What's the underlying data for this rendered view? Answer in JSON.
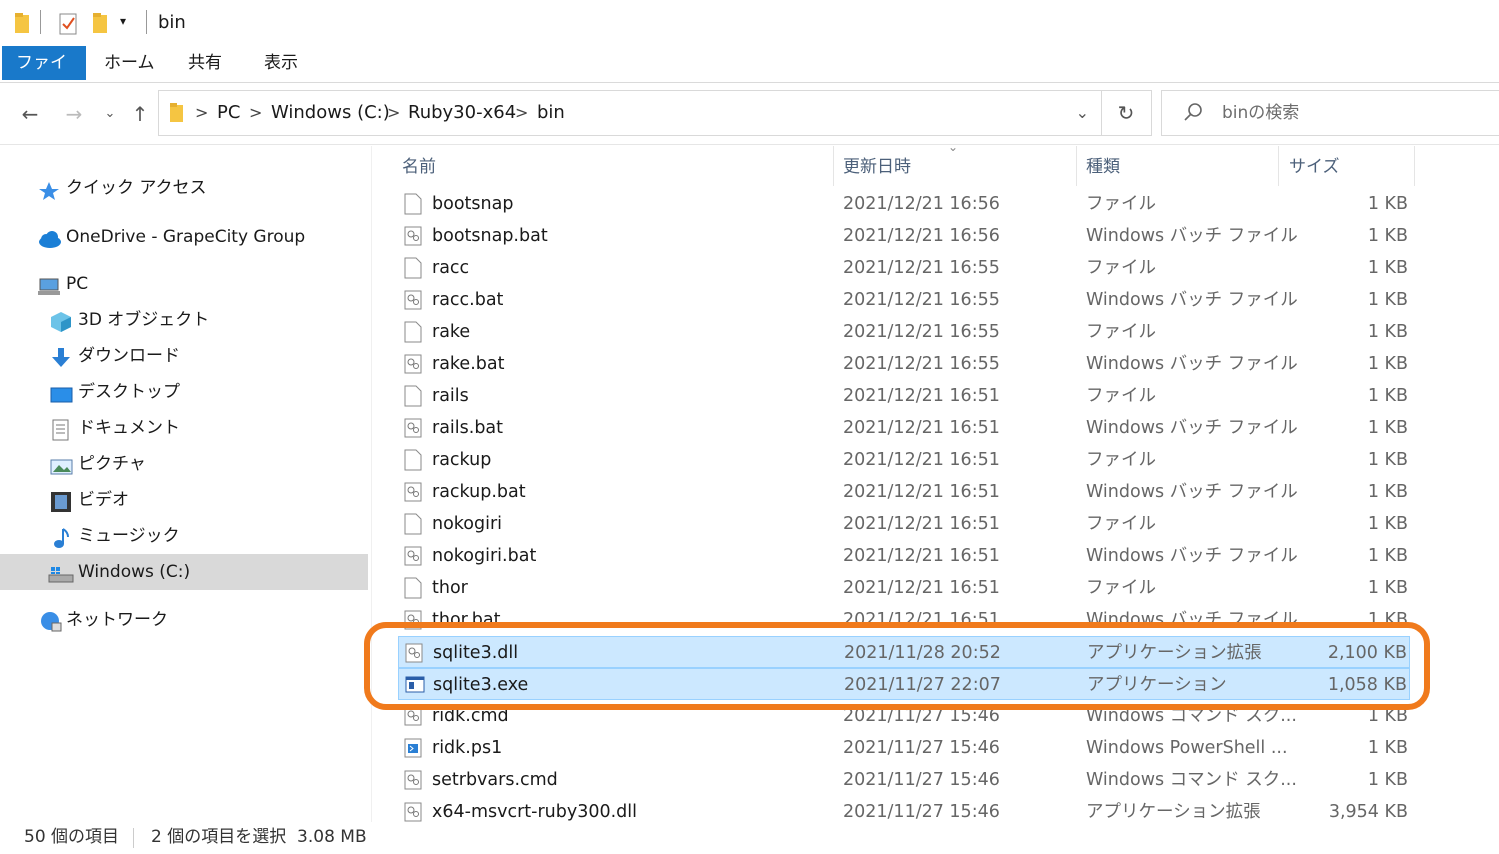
{
  "title": "bin",
  "colors": {
    "accent": "#1979ca",
    "selection": "#cce8ff",
    "highlight": "#f07a1c",
    "folder": "#f5c542"
  },
  "ribbon": {
    "tabs": [
      "ファイル",
      "ホーム",
      "共有",
      "表示"
    ]
  },
  "address": {
    "crumbs": [
      "PC",
      "Windows (C:)",
      "Ruby30-x64",
      "bin"
    ],
    "separator": ">"
  },
  "search": {
    "placeholder": "binの検索"
  },
  "nav": {
    "items": [
      {
        "label": "クイック アクセス",
        "icon": "star-icon"
      },
      {
        "label": "OneDrive - GrapeCity Group",
        "icon": "cloud-icon"
      },
      {
        "label": "PC",
        "icon": "pc-icon"
      },
      {
        "label": "3D オブジェクト",
        "icon": "cube-icon"
      },
      {
        "label": "ダウンロード",
        "icon": "download-icon"
      },
      {
        "label": "デスクトップ",
        "icon": "desktop-icon"
      },
      {
        "label": "ドキュメント",
        "icon": "document-icon"
      },
      {
        "label": "ピクチャ",
        "icon": "picture-icon"
      },
      {
        "label": "ビデオ",
        "icon": "video-icon"
      },
      {
        "label": "ミュージック",
        "icon": "music-icon"
      },
      {
        "label": "Windows (C:)",
        "icon": "drive-icon",
        "selected": true
      },
      {
        "label": "ネットワーク",
        "icon": "network-icon"
      }
    ]
  },
  "columns": {
    "name": "名前",
    "date": "更新日時",
    "type": "種類",
    "size": "サイズ"
  },
  "files": [
    {
      "name": "bootsnap",
      "date": "2021/12/21 16:56",
      "type": "ファイル",
      "size": "1 KB",
      "icon": "file-icon"
    },
    {
      "name": "bootsnap.bat",
      "date": "2021/12/21 16:56",
      "type": "Windows バッチ ファイル",
      "size": "1 KB",
      "icon": "batch-icon"
    },
    {
      "name": "racc",
      "date": "2021/12/21 16:55",
      "type": "ファイル",
      "size": "1 KB",
      "icon": "file-icon"
    },
    {
      "name": "racc.bat",
      "date": "2021/12/21 16:55",
      "type": "Windows バッチ ファイル",
      "size": "1 KB",
      "icon": "batch-icon"
    },
    {
      "name": "rake",
      "date": "2021/12/21 16:55",
      "type": "ファイル",
      "size": "1 KB",
      "icon": "file-icon"
    },
    {
      "name": "rake.bat",
      "date": "2021/12/21 16:55",
      "type": "Windows バッチ ファイル",
      "size": "1 KB",
      "icon": "batch-icon"
    },
    {
      "name": "rails",
      "date": "2021/12/21 16:51",
      "type": "ファイル",
      "size": "1 KB",
      "icon": "file-icon"
    },
    {
      "name": "rails.bat",
      "date": "2021/12/21 16:51",
      "type": "Windows バッチ ファイル",
      "size": "1 KB",
      "icon": "batch-icon"
    },
    {
      "name": "rackup",
      "date": "2021/12/21 16:51",
      "type": "ファイル",
      "size": "1 KB",
      "icon": "file-icon"
    },
    {
      "name": "rackup.bat",
      "date": "2021/12/21 16:51",
      "type": "Windows バッチ ファイル",
      "size": "1 KB",
      "icon": "batch-icon"
    },
    {
      "name": "nokogiri",
      "date": "2021/12/21 16:51",
      "type": "ファイル",
      "size": "1 KB",
      "icon": "file-icon"
    },
    {
      "name": "nokogiri.bat",
      "date": "2021/12/21 16:51",
      "type": "Windows バッチ ファイル",
      "size": "1 KB",
      "icon": "batch-icon"
    },
    {
      "name": "thor",
      "date": "2021/12/21 16:51",
      "type": "ファイル",
      "size": "1 KB",
      "icon": "file-icon"
    },
    {
      "name": "thor.bat",
      "date": "2021/12/21 16:51",
      "type": "Windows バッチ ファイル",
      "size": "1 KB",
      "icon": "batch-icon"
    },
    {
      "name": "sqlite3.dll",
      "date": "2021/11/28 20:52",
      "type": "アプリケーション拡張",
      "size": "2,100 KB",
      "icon": "dll-icon",
      "selected": true
    },
    {
      "name": "sqlite3.exe",
      "date": "2021/11/27 22:07",
      "type": "アプリケーション",
      "size": "1,058 KB",
      "icon": "exe-icon",
      "selected": true
    },
    {
      "name": "ridk.cmd",
      "date": "2021/11/27 15:46",
      "type": "Windows コマンド スク...",
      "size": "1 KB",
      "icon": "batch-icon"
    },
    {
      "name": "ridk.ps1",
      "date": "2021/11/27 15:46",
      "type": "Windows PowerShell ...",
      "size": "1 KB",
      "icon": "powershell-icon"
    },
    {
      "name": "setrbvars.cmd",
      "date": "2021/11/27 15:46",
      "type": "Windows コマンド スク...",
      "size": "1 KB",
      "icon": "batch-icon"
    },
    {
      "name": "x64-msvcrt-ruby300.dll",
      "date": "2021/11/27 15:46",
      "type": "アプリケーション拡張",
      "size": "3,954 KB",
      "icon": "dll-icon"
    }
  ],
  "status": {
    "count": "50 個の項目",
    "selection": "2 個の項目を選択  3.08 MB"
  }
}
